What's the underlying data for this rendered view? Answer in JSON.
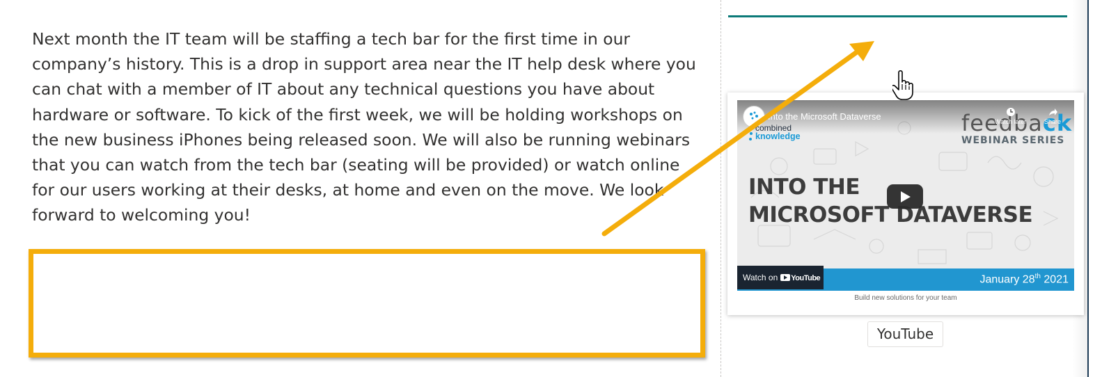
{
  "article": {
    "body": "Next month the IT team will be staffing a tech bar for the first time in our company’s history. This is a drop in support area near the IT help desk where you can chat with a member of IT about any technical questions you have about hardware or software. To kick of the first week, we will be holding workshops on the new business iPhones being released soon. We will also be running webinars that you can watch from the tech bar (seating will be provided) or watch online for our users working at their desks, at home and even on the move. We look forward to welcoming you!"
  },
  "video": {
    "title": "Into the Microsoft Dataverse",
    "channel_logo_line1": "combined",
    "channel_logo_line2": "knowledge",
    "brand": "feedba",
    "brand_accent": "ck",
    "series": "WEBINAR SERIES",
    "headline_line1": "INTO THE",
    "headline_line2": "MICROSOFT DATAVERSE",
    "date": "January 28",
    "date_suffix": "th",
    "year": " 2021",
    "watch_label": "Watch on",
    "youtube_word": "YouTube",
    "watch_later": "Watch later",
    "share": "Share",
    "caption": "Build new solutions for your team"
  },
  "youtube_button": {
    "label": "YouTube"
  },
  "colors": {
    "accent_orange": "#f4ad0b",
    "teal_line": "#0b7a78",
    "band_blue": "#2196d0"
  },
  "icons": [
    "play-icon",
    "clock-icon",
    "share-icon",
    "hand-cursor-icon",
    "arrow-annotation"
  ]
}
